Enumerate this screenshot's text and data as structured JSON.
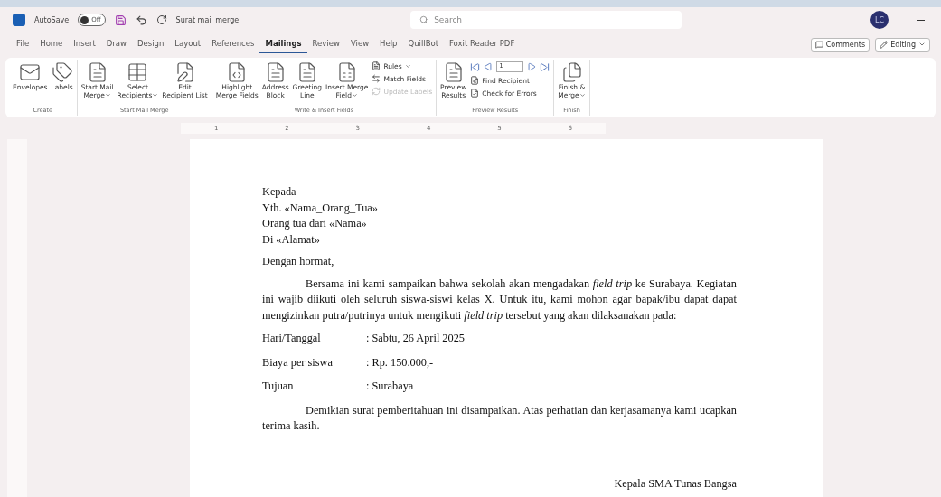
{
  "titlebar": {
    "autosave_label": "AutoSave",
    "autosave": {
      "label": "Off",
      "on": false
    },
    "document_title": "Surat mail merge",
    "search": {
      "placeholder": "Search"
    },
    "avatar": "LC"
  },
  "tabs": [
    {
      "label": "File",
      "selected": false
    },
    {
      "label": "Home",
      "selected": false
    },
    {
      "label": "Insert",
      "selected": false
    },
    {
      "label": "Draw",
      "selected": false
    },
    {
      "label": "Design",
      "selected": false
    },
    {
      "label": "Layout",
      "selected": false
    },
    {
      "label": "References",
      "selected": false
    },
    {
      "label": "Mailings",
      "selected": true
    },
    {
      "label": "Review",
      "selected": false
    },
    {
      "label": "View",
      "selected": false
    },
    {
      "label": "Help",
      "selected": false
    },
    {
      "label": "QuillBot",
      "selected": false
    },
    {
      "label": "Foxit Reader PDF",
      "selected": false
    }
  ],
  "header_actions": [
    {
      "kind": "comments",
      "label": "Comments"
    },
    {
      "kind": "editing",
      "label": "Editing"
    }
  ],
  "ribbon": [
    {
      "name": "Create",
      "items": [
        {
          "kind": "large",
          "lines": [
            "Envelopes"
          ],
          "dropdown": false
        },
        {
          "kind": "large",
          "lines": [
            "Labels"
          ],
          "dropdown": false
        }
      ]
    },
    {
      "name": "Start Mail Merge",
      "items": [
        {
          "kind": "large",
          "lines": [
            "Start Mail",
            "Merge"
          ],
          "dropdown": true
        },
        {
          "kind": "large",
          "lines": [
            "Select",
            "Recipients"
          ],
          "dropdown": true
        },
        {
          "kind": "large",
          "lines": [
            "Edit",
            "Recipient List"
          ],
          "dropdown": false
        }
      ]
    },
    {
      "name": "Write & Insert Fields",
      "items": [
        {
          "kind": "large",
          "lines": [
            "Highlight",
            "Merge Fields"
          ],
          "dropdown": false
        },
        {
          "kind": "large",
          "lines": [
            "Address",
            "Block"
          ],
          "dropdown": false
        },
        {
          "kind": "large",
          "lines": [
            "Greeting",
            "Line"
          ],
          "dropdown": false
        },
        {
          "kind": "large",
          "lines": [
            "Insert Merge",
            "Field"
          ],
          "dropdown": true
        },
        {
          "kind": "stack",
          "entries": [
            {
              "label": "Rules",
              "dropdown": true,
              "disabled": false
            },
            {
              "label": "Match Fields",
              "dropdown": false,
              "disabled": false
            },
            {
              "label": "Update Labels",
              "dropdown": false,
              "disabled": true
            }
          ]
        }
      ]
    },
    {
      "name": "Preview Results",
      "items": [
        {
          "kind": "large",
          "lines": [
            "Preview",
            "Results"
          ],
          "dropdown": false
        },
        {
          "kind": "nav",
          "record": "1",
          "entries": [
            {
              "label": "Find Recipient"
            },
            {
              "label": "Check for Errors"
            }
          ]
        }
      ]
    },
    {
      "name": "Finish",
      "items": [
        {
          "kind": "large",
          "lines": [
            "Finish &",
            "Merge"
          ],
          "dropdown": true
        }
      ]
    }
  ],
  "ruler": [
    "1",
    "2",
    "3",
    "4",
    "5",
    "6"
  ],
  "document": {
    "address_lines": [
      "Yth. «Nama_Orang_Tua»",
      "Orang tua dari «Nama»",
      "Di «Alamat»"
    ],
    "address_head": "Kepada",
    "greeting": "Dengan hormat,",
    "paragraph": "Bersama ini kami sampaikan bahwa sekolah akan mengadakan *field trip* ke Surabaya. Kegiatan ini wajib diikuti oleh seluruh siswa-siswi kelas X.  Untuk itu, kami mohon agar bapak/ibu dapat dapat mengizinkan putra/putrinya untuk mengikuti *field trip* tersebut yang akan dilaksanakan pada:",
    "details": [
      {
        "label": "Hari/Tanggal",
        "value": ": Sabtu, 26 April 2025"
      },
      {
        "label": "Biaya per siswa",
        "value": ": Rp. 150.000,-"
      },
      {
        "label": "Tujuan",
        "value": ": Surabaya"
      }
    ],
    "closing": "Demikian surat pemberitahuan ini disampaikan. Atas perhatian dan kerjasamanya kami ucapkan terima kasih.",
    "signature": "Kepala SMA Tunas Bangsa"
  }
}
